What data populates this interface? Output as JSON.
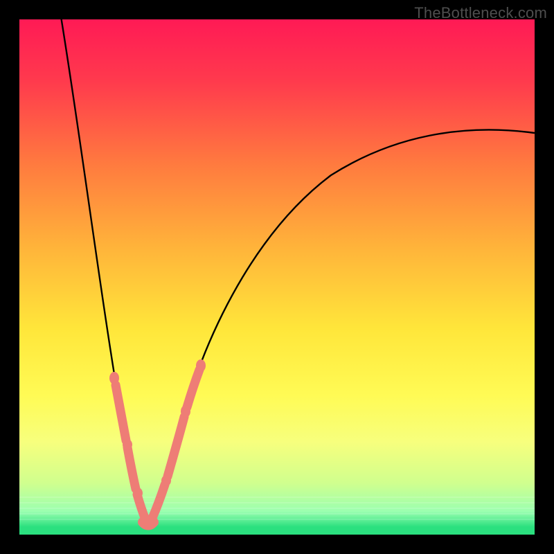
{
  "watermark": "TheBottleneck.com",
  "colors": {
    "frame": "#000000",
    "curve": "#000000",
    "salmon": "#ee7d76",
    "green_band": "#2be07f"
  },
  "chart_data": {
    "type": "line",
    "title": "",
    "xlabel": "",
    "ylabel": "",
    "xlim": [
      0,
      100
    ],
    "ylim": [
      0,
      100
    ],
    "gradient_stops": [
      {
        "offset": 0.0,
        "color": "#ff1a55"
      },
      {
        "offset": 0.12,
        "color": "#ff3a4d"
      },
      {
        "offset": 0.28,
        "color": "#ff7a3f"
      },
      {
        "offset": 0.45,
        "color": "#ffb63a"
      },
      {
        "offset": 0.6,
        "color": "#ffe63a"
      },
      {
        "offset": 0.73,
        "color": "#fffb55"
      },
      {
        "offset": 0.82,
        "color": "#f7ff7d"
      },
      {
        "offset": 0.9,
        "color": "#d0ff8e"
      },
      {
        "offset": 0.955,
        "color": "#9bffb0"
      },
      {
        "offset": 0.985,
        "color": "#2be07f"
      },
      {
        "offset": 1.0,
        "color": "#2be07f"
      }
    ],
    "curve": {
      "left_top_x": 8,
      "left_top_y": 100,
      "min_x": 25,
      "min_y": 2,
      "right_end_x": 100,
      "right_end_y": 78
    },
    "salmon_overlay": {
      "note": "Pink overlay markers on curve roughly between y≈8 and y≈28 (percent of plot height from bottom)",
      "left_branch_x_range": [
        18,
        24
      ],
      "right_branch_x_range": [
        26,
        34
      ],
      "y_range": [
        4,
        28
      ]
    }
  }
}
